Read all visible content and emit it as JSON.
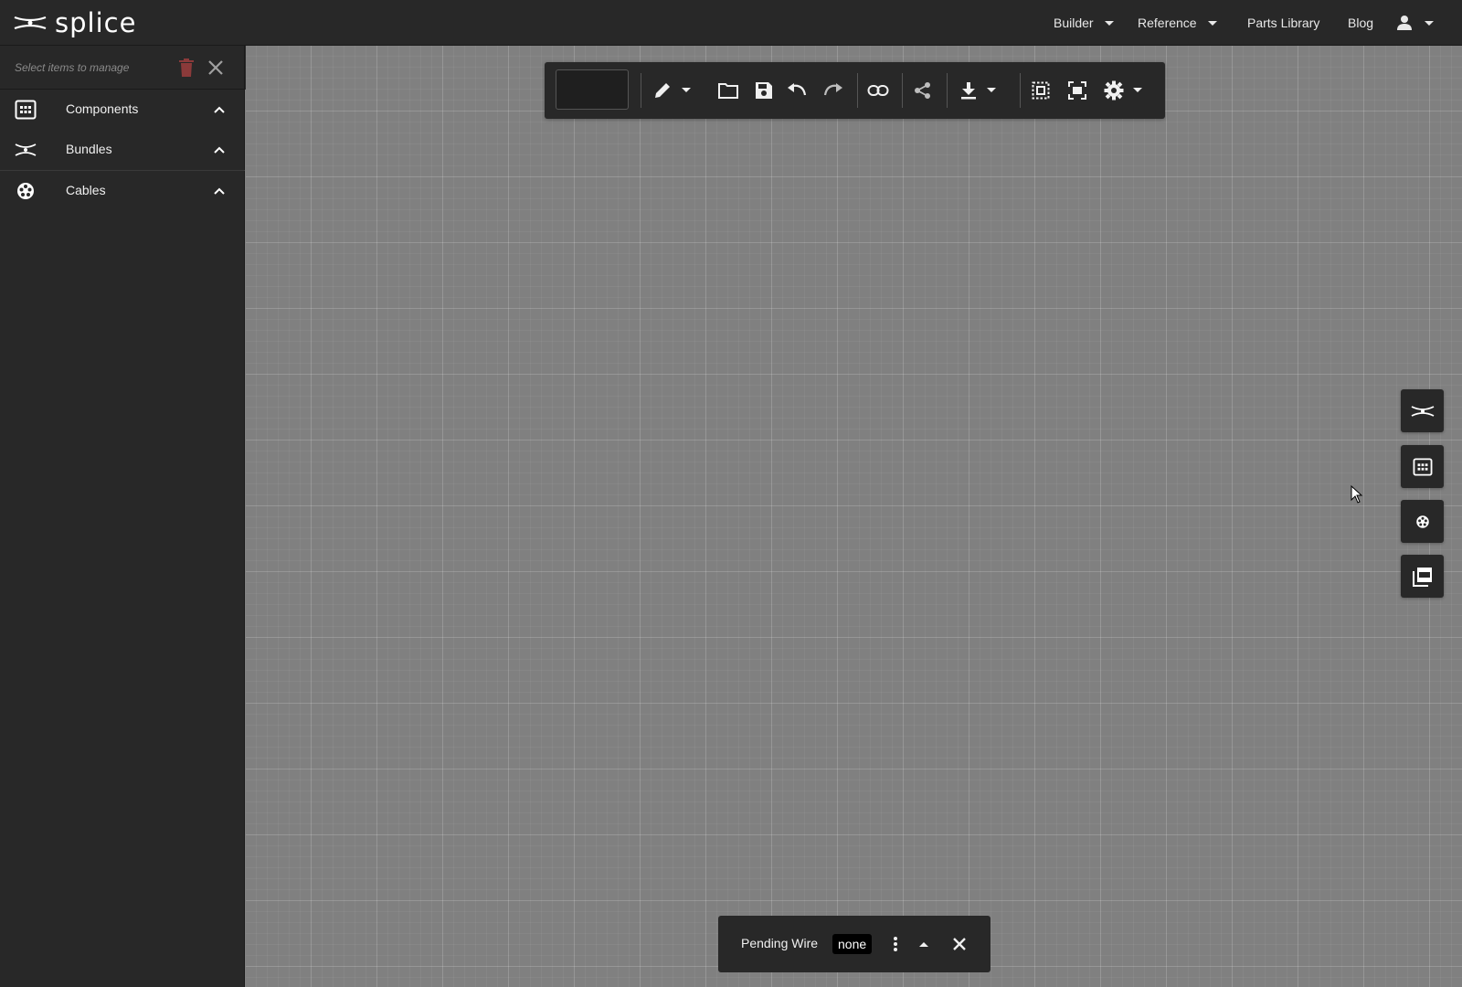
{
  "app": {
    "name": "splice"
  },
  "nav": {
    "builder": "Builder",
    "reference": "Reference",
    "parts_library": "Parts Library",
    "blog": "Blog"
  },
  "sidebar": {
    "manage_placeholder": "Select items to manage",
    "items": [
      {
        "label": "Components",
        "icon": "grid-icon"
      },
      {
        "label": "Bundles",
        "icon": "splice-icon"
      },
      {
        "label": "Cables",
        "icon": "cable-icon"
      }
    ]
  },
  "toolbar": {
    "name_value": "",
    "tools": [
      "pencil-icon",
      "folder-icon",
      "save-icon",
      "undo-icon",
      "redo-icon",
      "link-icon",
      "share-icon",
      "download-icon",
      "select-all-icon",
      "fit-screen-icon",
      "settings-icon"
    ]
  },
  "right_panel": {
    "buttons": [
      "splice-icon",
      "grid-icon",
      "cable-icon",
      "pdf-icon"
    ]
  },
  "pending": {
    "label": "Pending Wire",
    "value": "none"
  },
  "colors": {
    "bar_bg": "#282828",
    "canvas_bg": "#808080",
    "trash_red": "#8b3a3a"
  }
}
